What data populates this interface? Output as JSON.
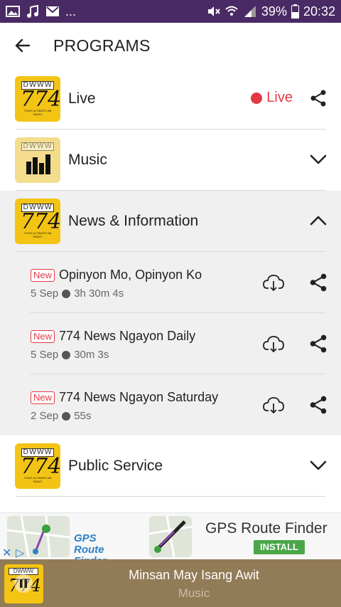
{
  "status_bar": {
    "dots": "...",
    "battery": "39%",
    "time": "20:32"
  },
  "app_bar": {
    "title": "PROGRAMS"
  },
  "programs": [
    {
      "label": "Live",
      "status": "Live"
    },
    {
      "label": "Music"
    },
    {
      "label": "News & Information"
    },
    {
      "label": "Public Service"
    }
  ],
  "logo": {
    "top": "DWWW",
    "number": "774",
    "tagline": "YOUR ULTIMATE AM RADIO"
  },
  "episodes": [
    {
      "badge": "New",
      "title": "Opinyon Mo, Opinyon Ko",
      "date": "5 Sep",
      "duration": "3h 30m 4s"
    },
    {
      "badge": "New",
      "title": "774 News Ngayon Daily",
      "date": "5 Sep",
      "duration": "30m 3s"
    },
    {
      "badge": "New",
      "title": "774 News Ngayon Saturday",
      "date": "2 Sep",
      "duration": "55s"
    }
  ],
  "ad": {
    "brand_line1": "GPS",
    "brand_line2": "Route",
    "brand_line3": "Finder",
    "title": "GPS Route Finder",
    "install": "INSTALL"
  },
  "player": {
    "song": "Minsan May Isang Awit",
    "subtitle": "Music"
  },
  "colors": {
    "status_bar": "#4a2a64",
    "accent_red": "#e43a44",
    "logo_yellow": "#f3c414",
    "player_bg": "#927b57",
    "install_green": "#4aa648"
  }
}
